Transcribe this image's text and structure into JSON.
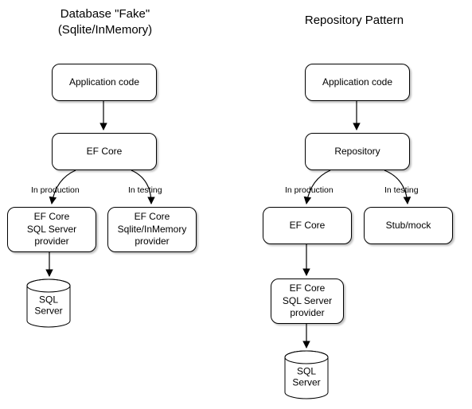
{
  "left": {
    "title": "Database \"Fake\"\n(Sqlite/InMemory)",
    "box_app": "Application code",
    "box_ef": "EF Core",
    "box_prod": "EF Core\nSQL Server\nprovider",
    "box_test": "EF Core\nSqlite/InMemory\nprovider",
    "label_prod": "In production",
    "label_test": "In testing",
    "cyl": "SQL\nServer"
  },
  "right": {
    "title": "Repository Pattern",
    "box_app": "Application code",
    "box_repo": "Repository",
    "box_ef": "EF Core",
    "box_stub": "Stub/mock",
    "box_prov": "EF Core\nSQL Server\nprovider",
    "label_prod": "In production",
    "label_test": "In testing",
    "cyl": "SQL\nServer"
  },
  "chart_data": [
    {
      "type": "flow-diagram",
      "title": "Database \"Fake\" (Sqlite/InMemory)",
      "nodes": [
        {
          "id": "app",
          "label": "Application code"
        },
        {
          "id": "ef",
          "label": "EF Core"
        },
        {
          "id": "prod",
          "label": "EF Core SQL Server provider"
        },
        {
          "id": "test",
          "label": "EF Core Sqlite/InMemory provider"
        },
        {
          "id": "db",
          "label": "SQL Server",
          "shape": "cylinder"
        }
      ],
      "edges": [
        {
          "from": "app",
          "to": "ef"
        },
        {
          "from": "ef",
          "to": "prod",
          "label": "In production"
        },
        {
          "from": "ef",
          "to": "test",
          "label": "In testing"
        },
        {
          "from": "prod",
          "to": "db"
        }
      ]
    },
    {
      "type": "flow-diagram",
      "title": "Repository Pattern",
      "nodes": [
        {
          "id": "app",
          "label": "Application code"
        },
        {
          "id": "repo",
          "label": "Repository"
        },
        {
          "id": "ef",
          "label": "EF Core"
        },
        {
          "id": "stub",
          "label": "Stub/mock"
        },
        {
          "id": "prov",
          "label": "EF Core SQL Server provider"
        },
        {
          "id": "db",
          "label": "SQL Server",
          "shape": "cylinder"
        }
      ],
      "edges": [
        {
          "from": "app",
          "to": "repo"
        },
        {
          "from": "repo",
          "to": "ef",
          "label": "In production"
        },
        {
          "from": "repo",
          "to": "stub",
          "label": "In testing"
        },
        {
          "from": "ef",
          "to": "prov"
        },
        {
          "from": "prov",
          "to": "db"
        }
      ]
    }
  ]
}
